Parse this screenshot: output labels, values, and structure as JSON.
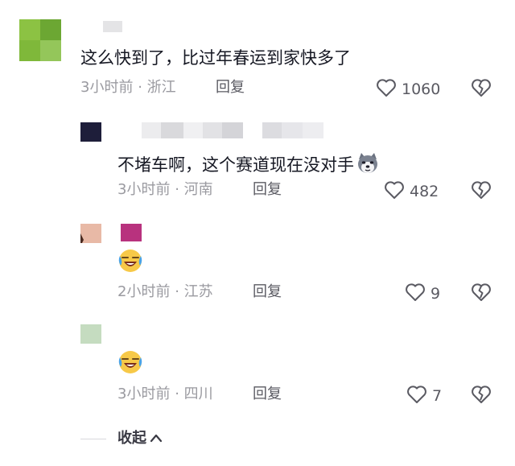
{
  "colors": {
    "text": "#161823",
    "meta": "#9a9aa0",
    "reply": "#5a5a62",
    "avatar_1": "#7fb83a",
    "avatar_2": "#1e1e3a",
    "avatar_3": "#e8b9a6",
    "avatar_3b": "#b8327e",
    "avatar_4": "#c5dcc0"
  },
  "comments": [
    {
      "content": "这么快到了，比过年春运到家快多了",
      "time": "3小时前",
      "location": "浙江",
      "reply_label": "回复",
      "likes": "1060",
      "like_icon": "heart-outline-icon",
      "dislike_icon": "broken-heart-icon"
    },
    {
      "content": "不堵车啊，这个赛道现在没对手",
      "time": "3小时前",
      "location": "河南",
      "reply_label": "回复",
      "likes": "482",
      "emoji": "husky-dog-emoji"
    },
    {
      "emoji": "laughing-crying-emoji",
      "time": "2小时前",
      "location": "江苏",
      "reply_label": "回复",
      "likes": "9"
    },
    {
      "emoji": "laughing-crying-emoji",
      "time": "3小时前",
      "location": "四川",
      "reply_label": "回复",
      "likes": "7"
    }
  ],
  "separator": "·",
  "collapse_label": "收起"
}
